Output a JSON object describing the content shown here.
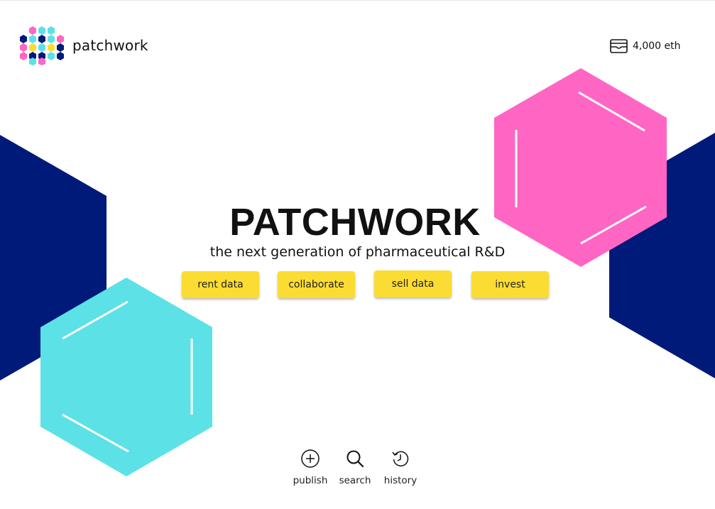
{
  "app": {
    "name": "patchwork"
  },
  "header": {
    "brand": "patchwork",
    "wallet": {
      "icon": "wallet-icon",
      "balance": "4,000 eth"
    }
  },
  "hero": {
    "title": "PATCHWORK",
    "subtitle": "the next generation of pharmaceutical R&D"
  },
  "actions": [
    {
      "label": "rent data"
    },
    {
      "label": "collaborate"
    },
    {
      "label": "sell data"
    },
    {
      "label": "invest"
    }
  ],
  "bottom_nav": [
    {
      "label": "publish",
      "icon": "plus-circle-icon"
    },
    {
      "label": "search",
      "icon": "search-icon"
    },
    {
      "label": "history",
      "icon": "history-icon"
    }
  ],
  "colors": {
    "navy": "#001a7a",
    "pink": "#ff66c4",
    "cyan": "#5ce1e6",
    "yellow": "#fbdc32"
  }
}
